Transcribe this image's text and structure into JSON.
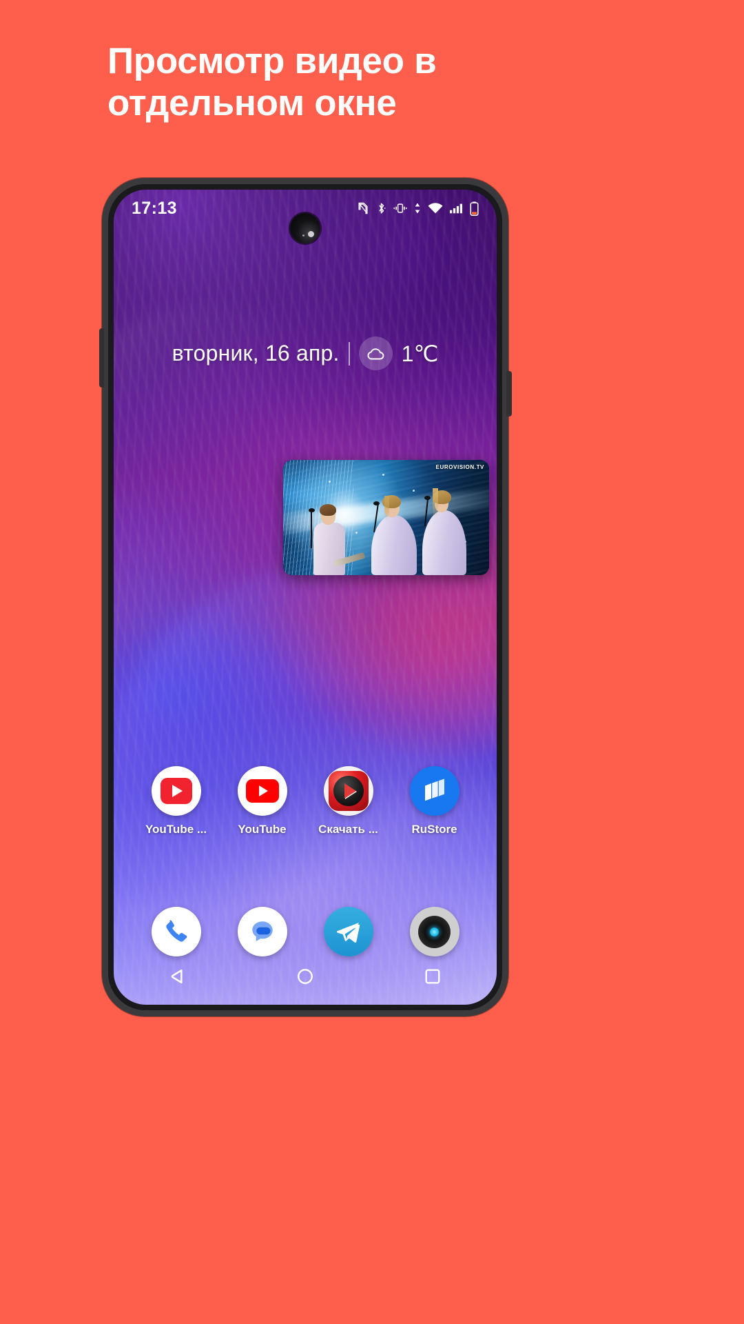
{
  "promo": {
    "headline": "Просмотр видео в отдельном окне",
    "background_color": "#fd5f4c",
    "text_color": "#ffffff"
  },
  "phone": {
    "statusbar": {
      "clock": "17:13",
      "icons": [
        {
          "name": "nfc-icon",
          "label": "NFC"
        },
        {
          "name": "bluetooth-icon",
          "label": "Bluetooth"
        },
        {
          "name": "vibrate-icon",
          "label": "Вибрация"
        },
        {
          "name": "data-transfer-icon",
          "label": "Передача данных"
        },
        {
          "name": "wifi-icon",
          "label": "Wi-Fi"
        },
        {
          "name": "cellular-signal-icon",
          "label": "Сигнал сети"
        },
        {
          "name": "battery-low-icon",
          "label": "Батарея"
        }
      ],
      "battery_color": "#ff6a2b"
    },
    "widget": {
      "date": "вторник, 16 апр.",
      "weather_icon": "cloud-icon",
      "temperature": "1℃"
    },
    "pip": {
      "watermark": "EUROVISION.TV"
    },
    "apps": [
      {
        "name": "app-youtube-premium",
        "label": "YouTube ...",
        "icon": "youtube-icon"
      },
      {
        "name": "app-youtube",
        "label": "YouTube",
        "icon": "youtube-icon"
      },
      {
        "name": "app-downloader",
        "label": "Скачать ...",
        "icon": "video-downloader-icon"
      },
      {
        "name": "app-rustore",
        "label": "RuStore",
        "icon": "rustore-icon"
      }
    ],
    "dock": [
      {
        "name": "dock-phone",
        "label": "Телефон",
        "icon": "phone-icon"
      },
      {
        "name": "dock-messages",
        "label": "Сообщения",
        "icon": "messages-icon"
      },
      {
        "name": "dock-telegram",
        "label": "Telegram",
        "icon": "telegram-icon"
      },
      {
        "name": "dock-camera",
        "label": "Камера",
        "icon": "camera-icon"
      }
    ],
    "navbar": [
      {
        "name": "nav-back-button",
        "label": "Назад",
        "icon": "back-triangle-icon"
      },
      {
        "name": "nav-home-button",
        "label": "Главная",
        "icon": "home-circle-icon"
      },
      {
        "name": "nav-recents-button",
        "label": "Обзор",
        "icon": "recents-square-icon"
      }
    ]
  }
}
